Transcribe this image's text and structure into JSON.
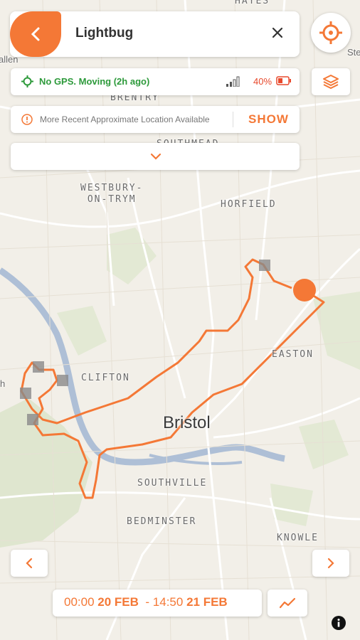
{
  "header": {
    "title": "Lightbug",
    "back_icon": "chevron-left-icon",
    "close_icon": "close-icon"
  },
  "status": {
    "gps_text": "No GPS. Moving (2h ago)",
    "battery_percent": "40%",
    "signal_icon": "signal-icon",
    "battery_icon": "battery-icon"
  },
  "notice": {
    "text": "More Recent Approximate Location Available",
    "action_label": "SHOW",
    "icon": "info-icon"
  },
  "expand": {
    "icon": "chevron-down-icon"
  },
  "map": {
    "labels": {
      "hayes": "HAYES",
      "brentry": "BRENTRY",
      "southmead": "SOUTHMEAD",
      "westbury": "WESTBURY-",
      "westbury2": "ON-TRYM",
      "horfield": "HORFIELD",
      "easton": "EASTON",
      "clifton": "CLIFTON",
      "bristol": "Bristol",
      "southville": "SOUTHVILLE",
      "bedminster": "BEDMINSTER",
      "knowle": "KNOWLE",
      "allen": "allen",
      "h": "h",
      "ste": "Ste"
    }
  },
  "date_range": {
    "start_time": "00:00",
    "start_date": "20 FEB",
    "separator": "-",
    "end_time": "14:50",
    "end_date": "21 FEB"
  },
  "colors": {
    "accent": "#f47836",
    "gps_green": "#2d9a3b",
    "battery_red": "#e8492c"
  }
}
